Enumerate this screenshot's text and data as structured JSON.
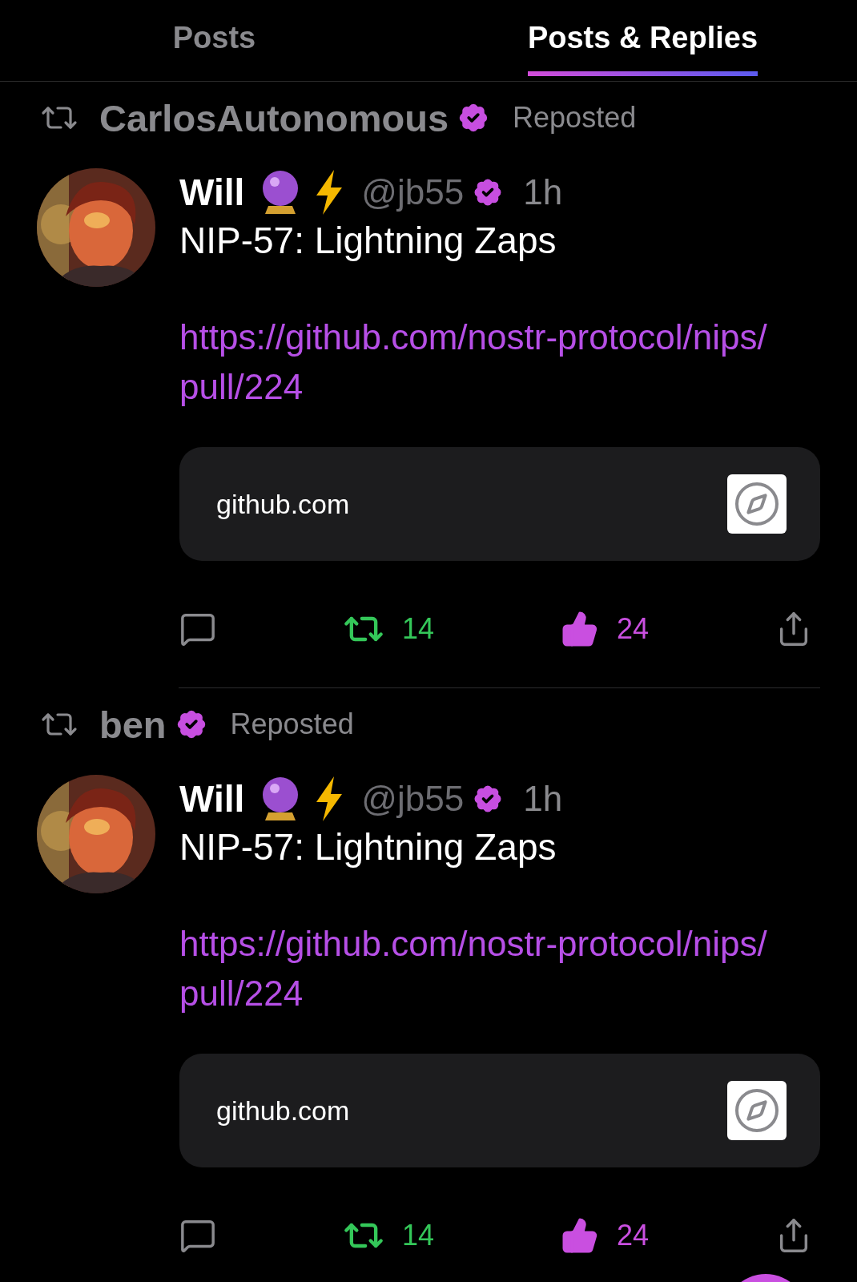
{
  "tabs": [
    {
      "label": "Posts",
      "selected": false
    },
    {
      "label": "Posts & Replies",
      "selected": true
    }
  ],
  "posts": [
    {
      "reposted_by": "CarlosAutonomous",
      "reposted_by_verified": true,
      "repost_label": "Reposted",
      "author": {
        "name": "Will",
        "handle": "@jb55",
        "verified": true
      },
      "time": "1h",
      "text": "NIP-57: Lightning Zaps",
      "link": "https://github.com/nostr-protocol/nips/pull/224",
      "preview": {
        "domain": "github.com"
      },
      "actions": {
        "reposts": "14",
        "reposted": true,
        "zaps": "24",
        "zapped": true
      }
    },
    {
      "reposted_by": "ben",
      "reposted_by_verified": true,
      "repost_label": "Reposted",
      "author": {
        "name": "Will",
        "handle": "@jb55",
        "verified": true
      },
      "time": "1h",
      "text": "NIP-57: Lightning Zaps",
      "link": "https://github.com/nostr-protocol/nips/pull/224",
      "preview": {
        "domain": "github.com"
      },
      "actions": {
        "reposts": "14",
        "reposted": true,
        "zaps": "24",
        "zapped": true
      }
    }
  ]
}
